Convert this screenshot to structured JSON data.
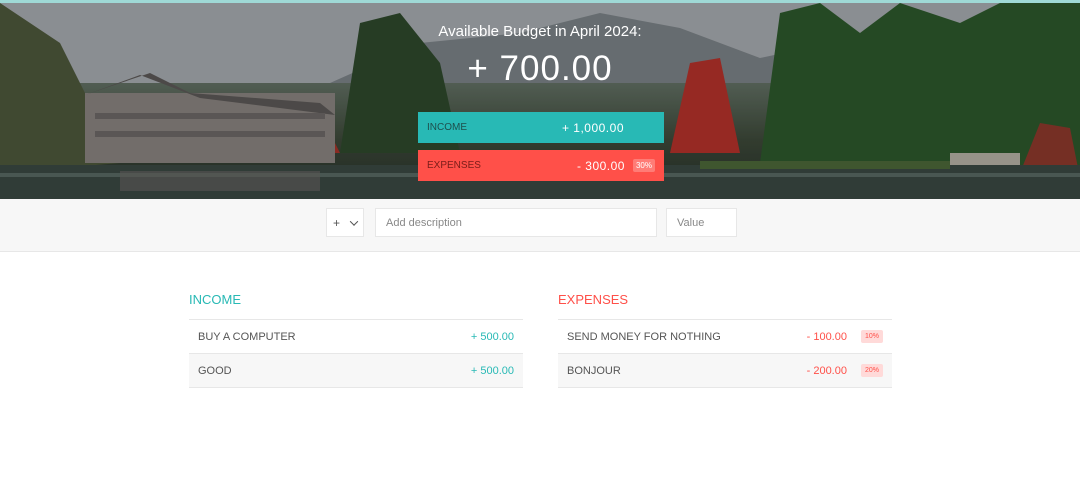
{
  "header": {
    "title": "Available Budget in April 2024:",
    "budget": "+ 700.00",
    "income_label": "Income",
    "income_value": "+ 1,000.00",
    "expenses_label": "Expenses",
    "expenses_value": "- 300.00",
    "expenses_percentage": "30%"
  },
  "add_form": {
    "type_value": "+",
    "description_placeholder": "Add description",
    "value_placeholder": "Value"
  },
  "income": {
    "title": "Income",
    "items": [
      {
        "description": "BUY A COMPUTER",
        "value": "+ 500.00"
      },
      {
        "description": "GOOD",
        "value": "+ 500.00"
      }
    ]
  },
  "expenses": {
    "title": "Expenses",
    "items": [
      {
        "description": "SEND MONEY FOR NOTHING",
        "value": "- 100.00",
        "percentage": "10%"
      },
      {
        "description": "BONJOUR",
        "value": "- 200.00",
        "percentage": "20%"
      }
    ]
  },
  "colors": {
    "income": "#28b9b5",
    "expenses": "#ff5049"
  }
}
